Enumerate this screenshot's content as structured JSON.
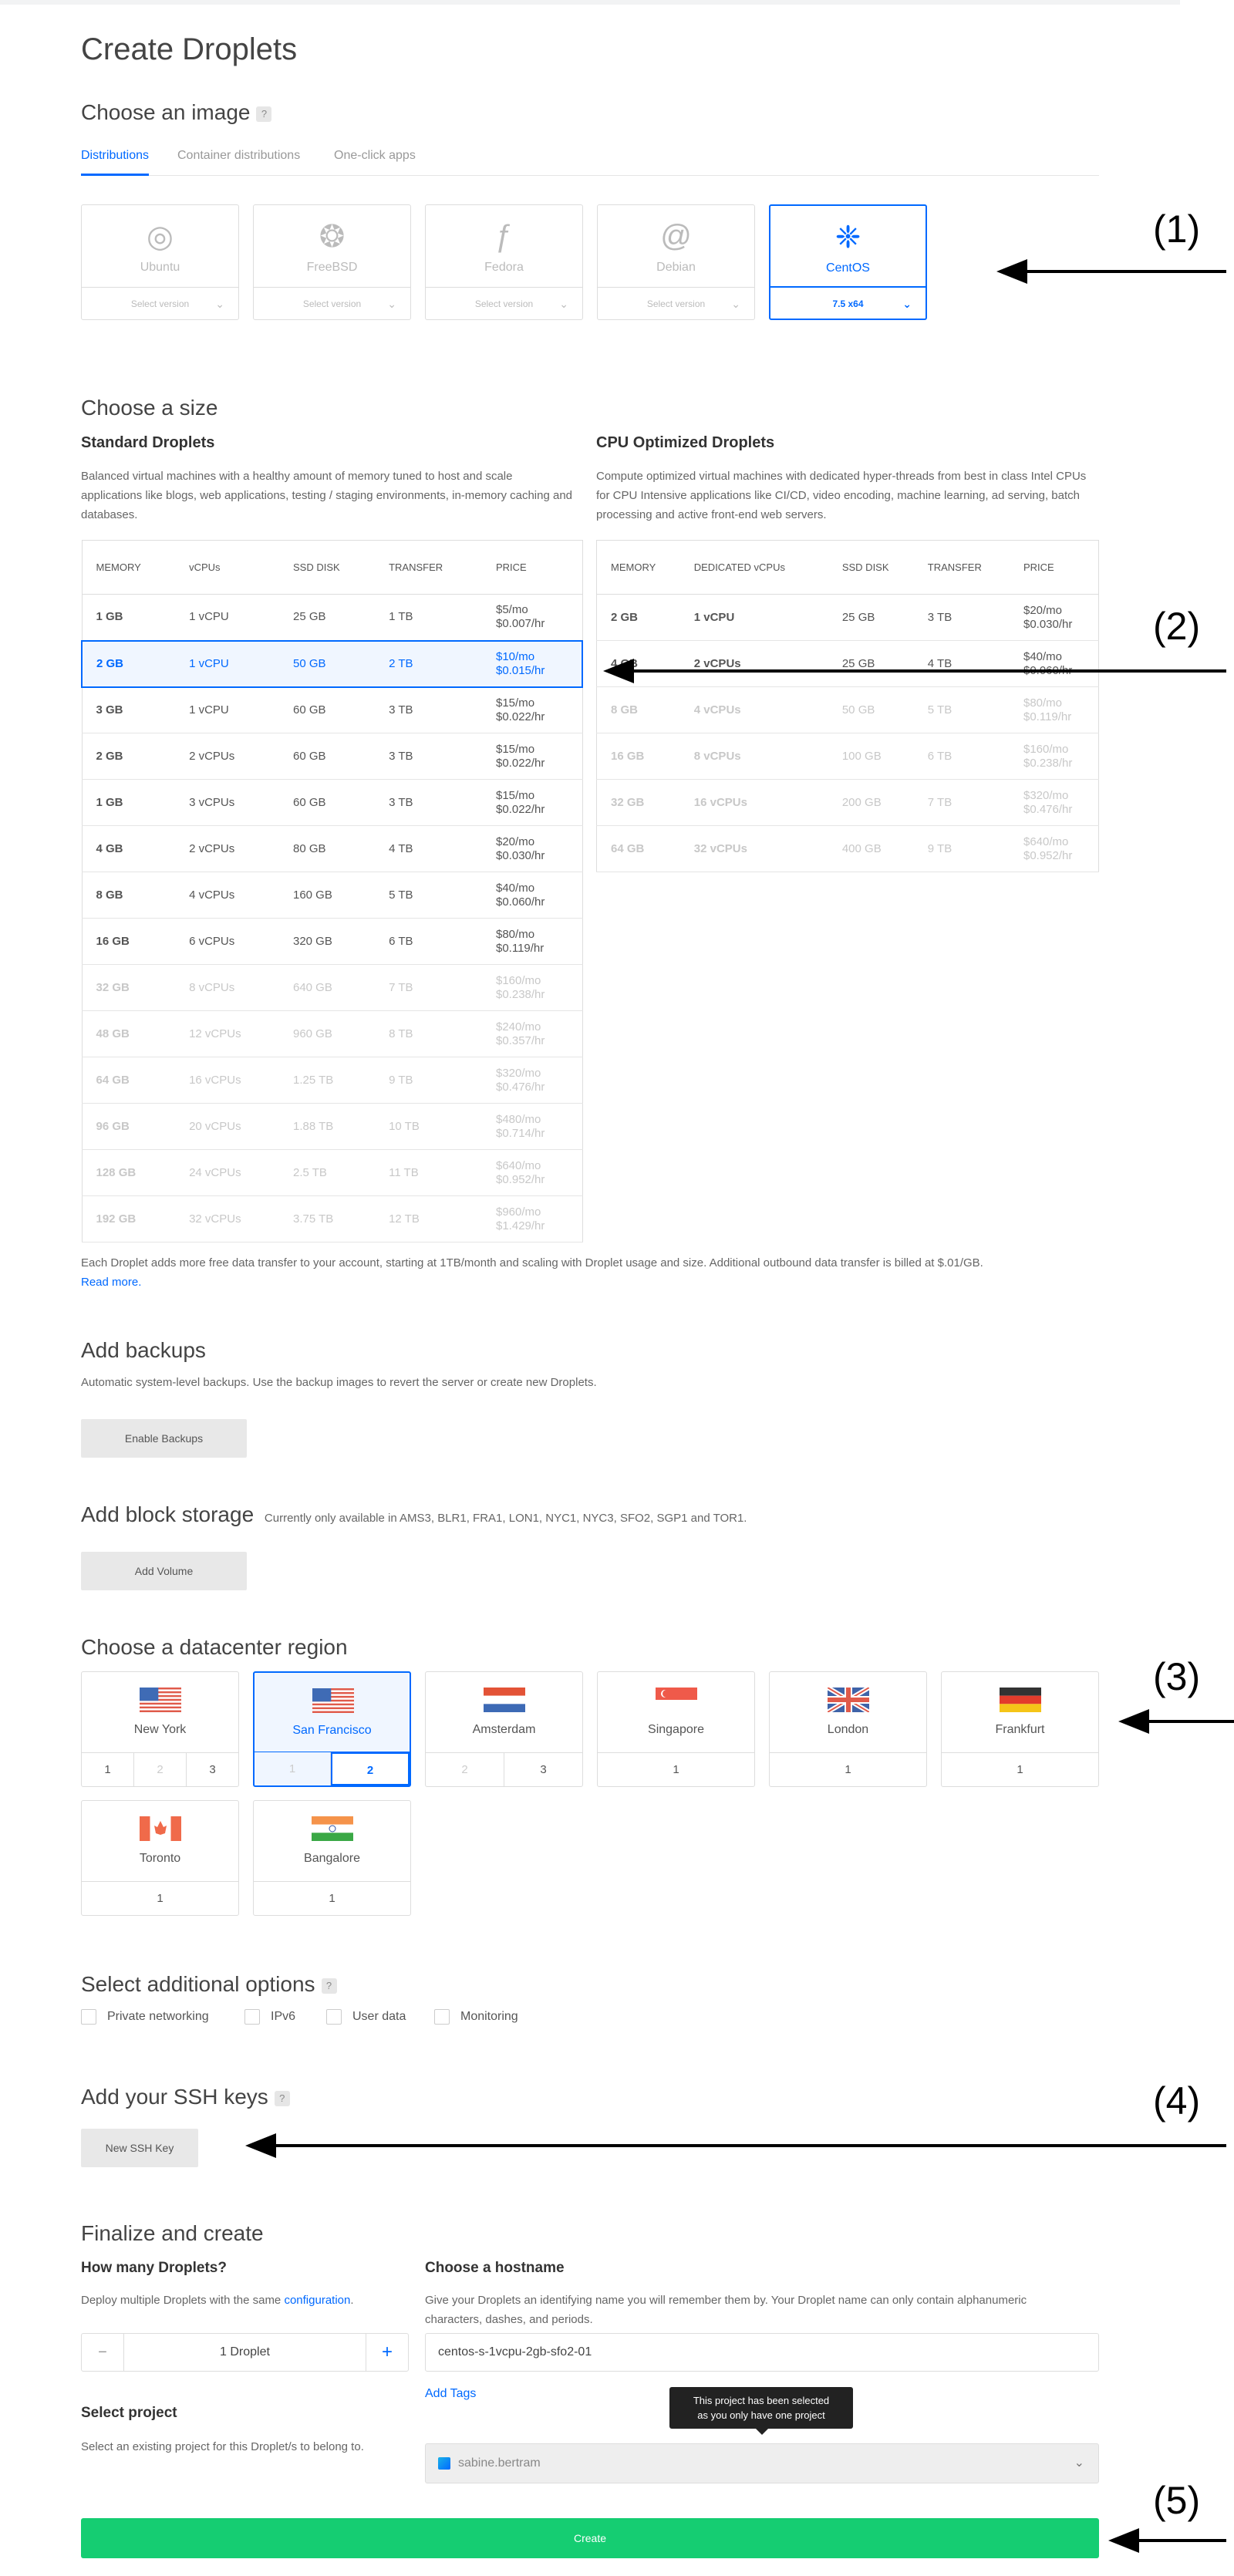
{
  "page_title": "Create Droplets",
  "image_section": {
    "heading": "Choose an image",
    "help": "?",
    "tabs": [
      "Distributions",
      "Container distributions",
      "One-click apps"
    ],
    "images": [
      {
        "name": "Ubuntu",
        "version": "Select version",
        "icon": "ubuntu-icon"
      },
      {
        "name": "FreeBSD",
        "version": "Select version",
        "icon": "freebsd-icon"
      },
      {
        "name": "Fedora",
        "version": "Select version",
        "icon": "fedora-icon"
      },
      {
        "name": "Debian",
        "version": "Select version",
        "icon": "debian-icon"
      },
      {
        "name": "CentOS",
        "version": "7.5 x64",
        "icon": "centos-icon",
        "selected": true
      }
    ]
  },
  "size_section": {
    "heading": "Choose a size",
    "standard": {
      "title": "Standard Droplets",
      "description": "Balanced virtual machines with a healthy amount of memory tuned to host and scale applications like blogs, web applications, testing / staging environments, in-memory caching and databases.",
      "headers": [
        "MEMORY",
        "vCPUs",
        "SSD DISK",
        "TRANSFER",
        "PRICE"
      ],
      "rows": [
        {
          "mem": "1 GB",
          "cpu": "1 vCPU",
          "disk": "25 GB",
          "transfer": "1 TB",
          "price_mo": "$5/mo",
          "price_hr": "$0.007/hr",
          "state": "normal"
        },
        {
          "mem": "2 GB",
          "cpu": "1 vCPU",
          "disk": "50 GB",
          "transfer": "2 TB",
          "price_mo": "$10/mo",
          "price_hr": "$0.015/hr",
          "state": "selected"
        },
        {
          "mem": "3 GB",
          "cpu": "1 vCPU",
          "disk": "60 GB",
          "transfer": "3 TB",
          "price_mo": "$15/mo",
          "price_hr": "$0.022/hr",
          "state": "normal"
        },
        {
          "mem": "2 GB",
          "cpu": "2 vCPUs",
          "disk": "60 GB",
          "transfer": "3 TB",
          "price_mo": "$15/mo",
          "price_hr": "$0.022/hr",
          "state": "normal"
        },
        {
          "mem": "1 GB",
          "cpu": "3 vCPUs",
          "disk": "60 GB",
          "transfer": "3 TB",
          "price_mo": "$15/mo",
          "price_hr": "$0.022/hr",
          "state": "normal"
        },
        {
          "mem": "4 GB",
          "cpu": "2 vCPUs",
          "disk": "80 GB",
          "transfer": "4 TB",
          "price_mo": "$20/mo",
          "price_hr": "$0.030/hr",
          "state": "normal"
        },
        {
          "mem": "8 GB",
          "cpu": "4 vCPUs",
          "disk": "160 GB",
          "transfer": "5 TB",
          "price_mo": "$40/mo",
          "price_hr": "$0.060/hr",
          "state": "normal"
        },
        {
          "mem": "16 GB",
          "cpu": "6 vCPUs",
          "disk": "320 GB",
          "transfer": "6 TB",
          "price_mo": "$80/mo",
          "price_hr": "$0.119/hr",
          "state": "normal"
        },
        {
          "mem": "32 GB",
          "cpu": "8 vCPUs",
          "disk": "640 GB",
          "transfer": "7 TB",
          "price_mo": "$160/mo",
          "price_hr": "$0.238/hr",
          "state": "disabled"
        },
        {
          "mem": "48 GB",
          "cpu": "12 vCPUs",
          "disk": "960 GB",
          "transfer": "8 TB",
          "price_mo": "$240/mo",
          "price_hr": "$0.357/hr",
          "state": "disabled"
        },
        {
          "mem": "64 GB",
          "cpu": "16 vCPUs",
          "disk": "1.25 TB",
          "transfer": "9 TB",
          "price_mo": "$320/mo",
          "price_hr": "$0.476/hr",
          "state": "disabled"
        },
        {
          "mem": "96 GB",
          "cpu": "20 vCPUs",
          "disk": "1.88 TB",
          "transfer": "10 TB",
          "price_mo": "$480/mo",
          "price_hr": "$0.714/hr",
          "state": "disabled"
        },
        {
          "mem": "128 GB",
          "cpu": "24 vCPUs",
          "disk": "2.5 TB",
          "transfer": "11 TB",
          "price_mo": "$640/mo",
          "price_hr": "$0.952/hr",
          "state": "disabled"
        },
        {
          "mem": "192 GB",
          "cpu": "32 vCPUs",
          "disk": "3.75 TB",
          "transfer": "12 TB",
          "price_mo": "$960/mo",
          "price_hr": "$1.429/hr",
          "state": "disabled"
        }
      ]
    },
    "cpu_optimized": {
      "title": "CPU Optimized Droplets",
      "description": "Compute optimized virtual machines with dedicated hyper-threads from best in class Intel CPUs for CPU Intensive applications like CI/CD, video encoding, machine learning, ad serving, batch processing and active front-end web servers.",
      "headers": [
        "MEMORY",
        "DEDICATED vCPUs",
        "SSD DISK",
        "TRANSFER",
        "PRICE"
      ],
      "rows": [
        {
          "mem": "2 GB",
          "cpu": "1 vCPU",
          "disk": "25 GB",
          "transfer": "3 TB",
          "price_mo": "$20/mo",
          "price_hr": "$0.030/hr",
          "state": "normal"
        },
        {
          "mem": "4 GB",
          "cpu": "2 vCPUs",
          "disk": "25 GB",
          "transfer": "4 TB",
          "price_mo": "$40/mo",
          "price_hr": "$0.060/hr",
          "state": "normal"
        },
        {
          "mem": "8 GB",
          "cpu": "4 vCPUs",
          "disk": "50 GB",
          "transfer": "5 TB",
          "price_mo": "$80/mo",
          "price_hr": "$0.119/hr",
          "state": "disabled"
        },
        {
          "mem": "16 GB",
          "cpu": "8 vCPUs",
          "disk": "100 GB",
          "transfer": "6 TB",
          "price_mo": "$160/mo",
          "price_hr": "$0.238/hr",
          "state": "disabled"
        },
        {
          "mem": "32 GB",
          "cpu": "16 vCPUs",
          "disk": "200 GB",
          "transfer": "7 TB",
          "price_mo": "$320/mo",
          "price_hr": "$0.476/hr",
          "state": "disabled"
        },
        {
          "mem": "64 GB",
          "cpu": "32 vCPUs",
          "disk": "400 GB",
          "transfer": "9 TB",
          "price_mo": "$640/mo",
          "price_hr": "$0.952/hr",
          "state": "disabled"
        }
      ]
    },
    "footnote": "Each Droplet adds more free data transfer to your account, starting at 1TB/month and scaling with Droplet usage and size. Additional outbound data transfer is billed at $.01/GB.",
    "read_more": "Read more."
  },
  "backups": {
    "heading": "Add backups",
    "description": "Automatic system-level backups. Use the backup images to revert the server or create new Droplets.",
    "button": "Enable Backups"
  },
  "block_storage": {
    "heading": "Add block storage",
    "note": "Currently only available in AMS3, BLR1, FRA1, LON1, NYC1, NYC3, SFO2, SGP1 and TOR1.",
    "button": "Add Volume"
  },
  "datacenter": {
    "heading": "Choose a datacenter region",
    "regions": [
      {
        "name": "New York",
        "flag": "us-flag",
        "nums": [
          "1",
          "2",
          "3"
        ],
        "disabled": [
          1
        ],
        "selected": false
      },
      {
        "name": "San Francisco",
        "flag": "us-flag",
        "nums": [
          "1",
          "2"
        ],
        "disabled": [
          0
        ],
        "selected": true,
        "active": 1
      },
      {
        "name": "Amsterdam",
        "flag": "nl-flag",
        "nums": [
          "2",
          "3"
        ],
        "disabled": [
          0
        ],
        "selected": false
      },
      {
        "name": "Singapore",
        "flag": "sg-flag",
        "nums": [
          "1"
        ],
        "disabled": [],
        "selected": false
      },
      {
        "name": "London",
        "flag": "uk-flag",
        "nums": [
          "1"
        ],
        "disabled": [],
        "selected": false
      },
      {
        "name": "Frankfurt",
        "flag": "de-flag",
        "nums": [
          "1"
        ],
        "disabled": [],
        "selected": false
      },
      {
        "name": "Toronto",
        "flag": "ca-flag",
        "nums": [
          "1"
        ],
        "disabled": [],
        "selected": false
      },
      {
        "name": "Bangalore",
        "flag": "in-flag",
        "nums": [
          "1"
        ],
        "disabled": [],
        "selected": false
      }
    ]
  },
  "options": {
    "heading": "Select additional options",
    "help": "?",
    "items": [
      "Private networking",
      "IPv6",
      "User data",
      "Monitoring"
    ]
  },
  "ssh": {
    "heading": "Add your SSH keys",
    "help": "?",
    "button": "New SSH Key"
  },
  "finalize": {
    "heading": "Finalize and create",
    "how_many": {
      "title": "How many Droplets?",
      "desc_prefix": "Deploy multiple Droplets with the same ",
      "desc_link": "configuration",
      "desc_suffix": ".",
      "count_label": "1  Droplet",
      "minus": "−",
      "plus": "+"
    },
    "hostname": {
      "title": "Choose a hostname",
      "description": "Give your Droplets an identifying name you will remember them by. Your Droplet name can only contain alphanumeric characters, dashes, and periods.",
      "value": "centos-s-1vcpu-2gb-sfo2-01",
      "add_tags": "Add Tags"
    },
    "project": {
      "title": "Select project",
      "description": "Select an existing project for this Droplet/s to belong to.",
      "value": "sabine.bertram",
      "tooltip_line1": "This project has been selected",
      "tooltip_line2": "as you only have one project"
    },
    "create_button": "Create"
  },
  "annotations": [
    "(1)",
    "(2)",
    "(3)",
    "(4)",
    "(5)"
  ],
  "colors": {
    "accent": "#0069ff",
    "create": "#15cd72"
  }
}
